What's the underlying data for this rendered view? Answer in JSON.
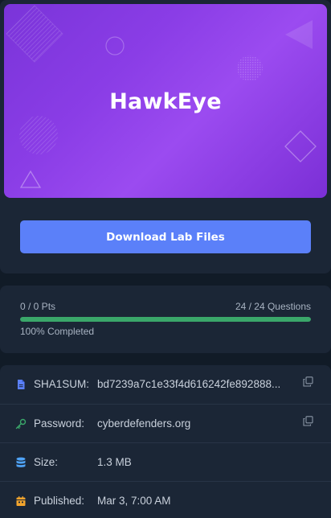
{
  "lab": {
    "title": "HawkEye",
    "download_label": "Download Lab Files"
  },
  "progress": {
    "points_text": "0 / 0 Pts",
    "questions_text": "24 / 24 Questions",
    "completed_text": "100% Completed",
    "completed_fraction": 1.0
  },
  "details": {
    "sha1": {
      "label": "SHA1SUM:",
      "value": "bd7239a7c1e33f4d616242fe892888..."
    },
    "password": {
      "label": "Password:",
      "value": "cyberdefenders.org"
    },
    "size": {
      "label": "Size:",
      "value": "1.3 MB"
    },
    "published": {
      "label": "Published:",
      "value": "Mar 3, 7:00 AM"
    }
  },
  "icons": {
    "file": "file-icon",
    "key": "key-icon",
    "database": "database-icon",
    "calendar": "calendar-icon",
    "copy": "copy-icon"
  },
  "colors": {
    "accent_button": "#5b80f9",
    "progress_fill": "#3aa76a",
    "banner_gradient_start": "#7a34d9",
    "banner_gradient_end": "#9b4bf0",
    "file_icon": "#5b80f9",
    "key_icon": "#3aa76a",
    "database_icon": "#4fa3f7",
    "calendar_icon": "#f2a42d"
  }
}
